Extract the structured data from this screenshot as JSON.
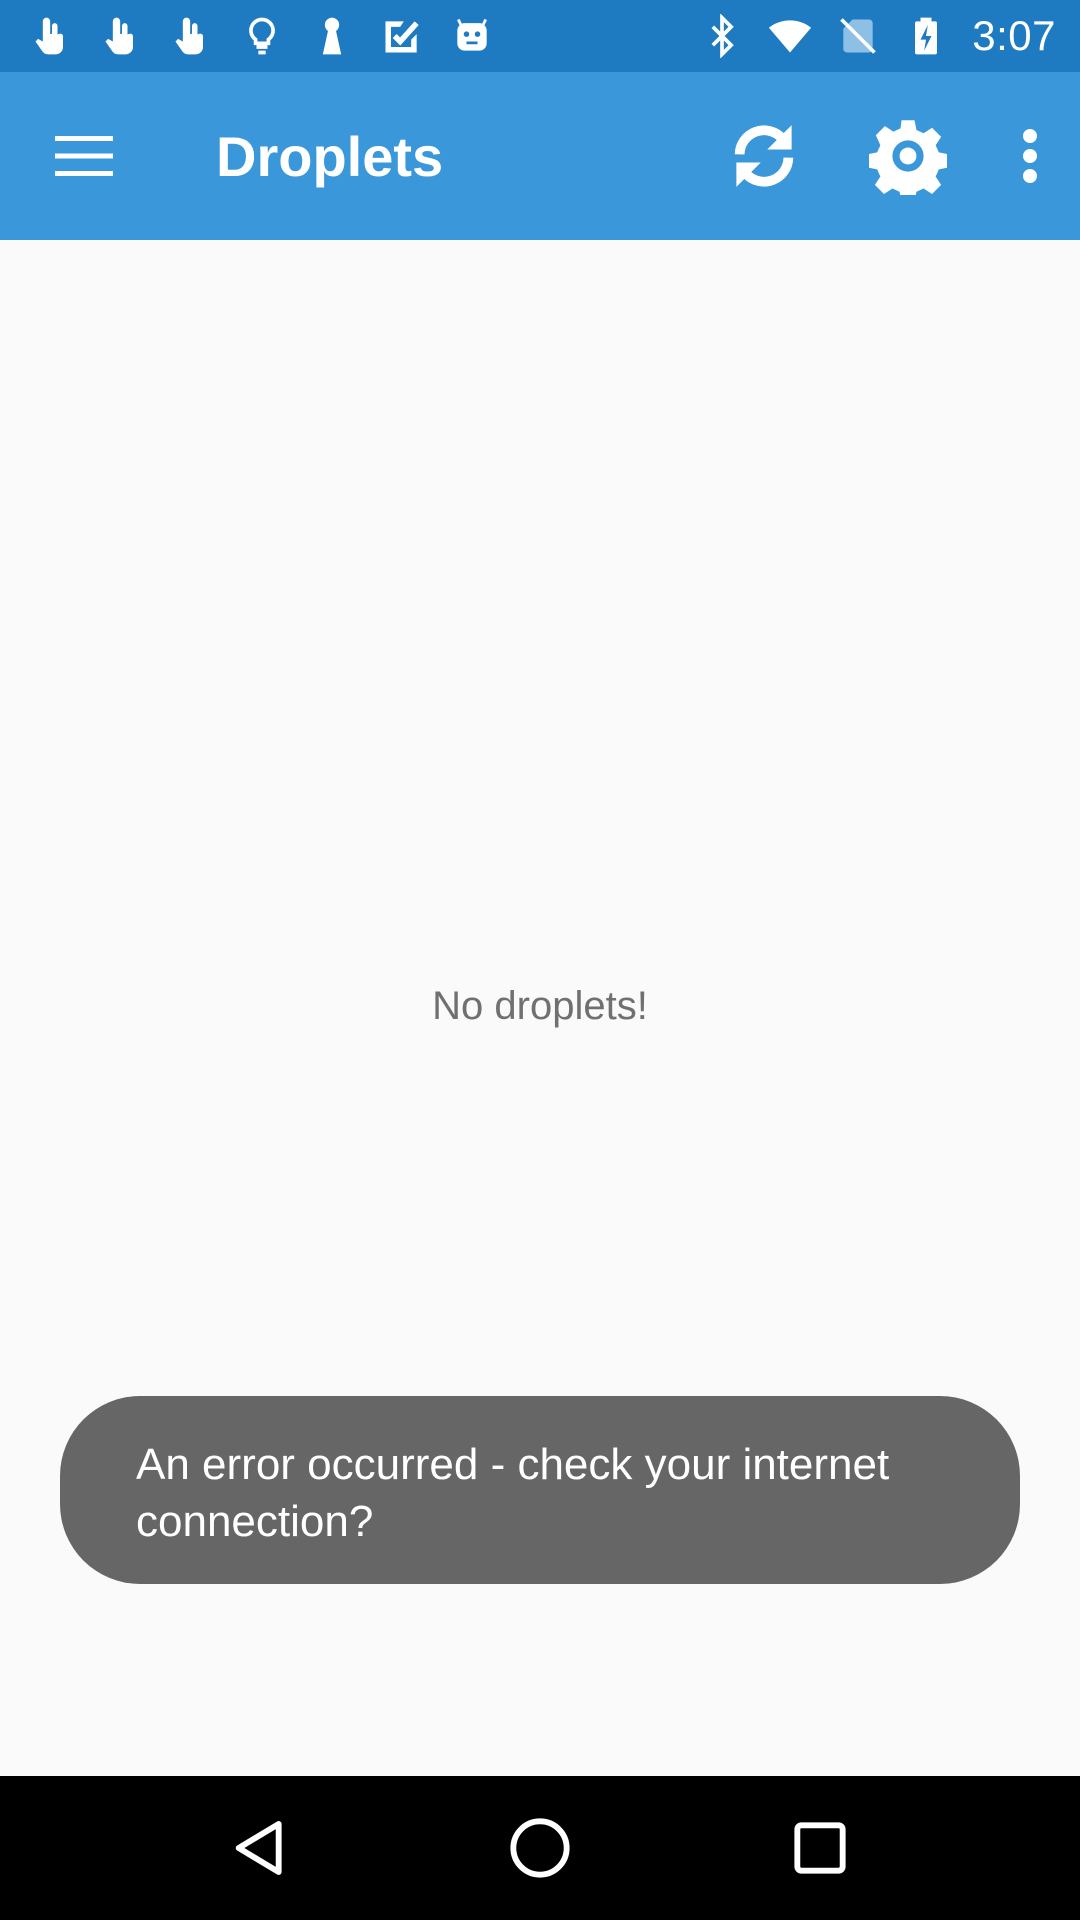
{
  "status_bar": {
    "time": "3:07",
    "left_icons": [
      "hand-pointer-icon",
      "hand-pointer-icon",
      "hand-pointer-icon",
      "lightbulb-icon",
      "keyhole-icon",
      "checkmark-notification-icon",
      "android-icon"
    ],
    "right_icons": [
      "bluetooth-icon",
      "wifi-icon",
      "no-sim-icon",
      "battery-charging-icon"
    ]
  },
  "app_bar": {
    "title": "Droplets",
    "actions": [
      "refresh-icon",
      "settings-icon",
      "overflow-menu-icon"
    ]
  },
  "content": {
    "empty_message": "No droplets!"
  },
  "toast": {
    "message": "An error occurred - check your internet connection?"
  },
  "navigation": {
    "buttons": [
      "back",
      "home",
      "recents"
    ]
  },
  "colors": {
    "status_bar": "#1E7BC1",
    "app_bar": "#3A97DA",
    "background": "#FAFAFA",
    "toast": "#666666",
    "nav_bar": "#000000"
  }
}
